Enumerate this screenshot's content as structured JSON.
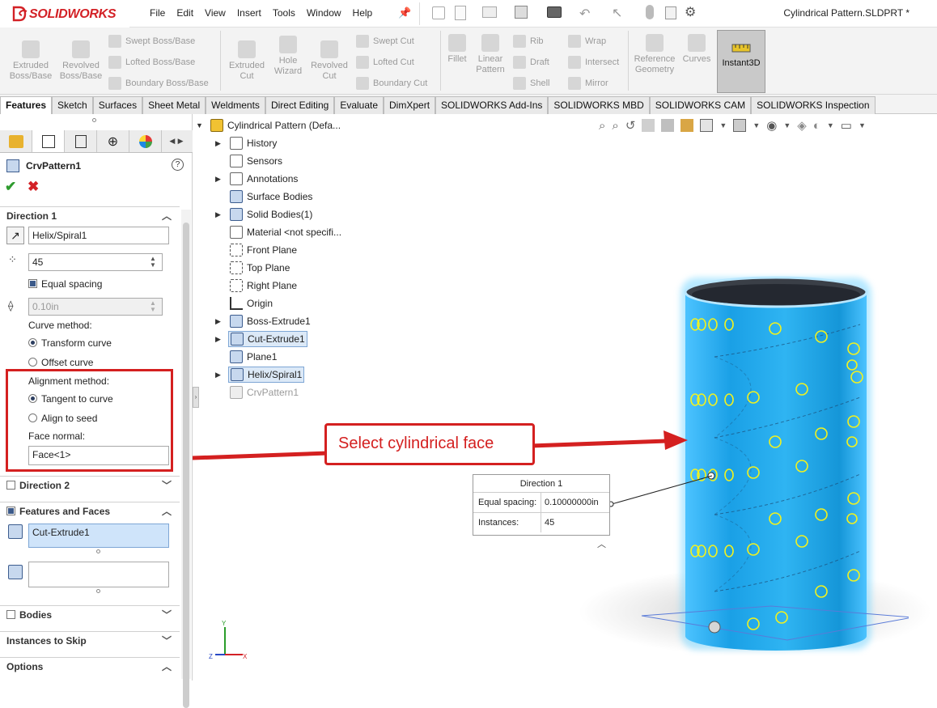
{
  "app": {
    "brand": "SOLIDWORKS",
    "menu": [
      "File",
      "Edit",
      "View",
      "Insert",
      "Tools",
      "Window",
      "Help"
    ],
    "document_title": "Cylindrical Pattern.SLDPRT *"
  },
  "ribbon": {
    "extruded_boss": "Extruded Boss/Base",
    "revolved_boss": "Revolved Boss/Base",
    "swept_boss": "Swept Boss/Base",
    "lofted_boss": "Lofted Boss/Base",
    "boundary_boss": "Boundary Boss/Base",
    "extruded_cut": "Extruded Cut",
    "hole_wizard": "Hole Wizard",
    "revolved_cut": "Revolved Cut",
    "swept_cut": "Swept Cut",
    "lofted_cut": "Lofted Cut",
    "boundary_cut": "Boundary Cut",
    "fillet": "Fillet",
    "linear_pattern": "Linear Pattern",
    "rib": "Rib",
    "draft": "Draft",
    "shell": "Shell",
    "wrap": "Wrap",
    "intersect": "Intersect",
    "mirror": "Mirror",
    "reference_geometry": "Reference Geometry",
    "curves": "Curves",
    "instant3d": "Instant3D"
  },
  "tabs": [
    "Features",
    "Sketch",
    "Surfaces",
    "Sheet Metal",
    "Weldments",
    "Direct Editing",
    "Evaluate",
    "DimXpert",
    "SOLIDWORKS Add-Ins",
    "SOLIDWORKS MBD",
    "SOLIDWORKS CAM",
    "SOLIDWORKS Inspection"
  ],
  "property_manager": {
    "feature_name": "CrvPattern1",
    "direction1": {
      "header": "Direction 1",
      "curve": "Helix/Spiral1",
      "instances": "45",
      "equal_spacing_label": "Equal spacing",
      "spacing": "0.10in",
      "curve_method_label": "Curve method:",
      "transform_curve": "Transform curve",
      "offset_curve": "Offset curve",
      "alignment_method_label": "Alignment method:",
      "tangent_to_curve": "Tangent to curve",
      "align_to_seed": "Align to seed",
      "face_normal_label": "Face normal:",
      "face_normal": "Face<1>"
    },
    "direction2_header": "Direction 2",
    "features_faces_header": "Features and Faces",
    "features_selected": "Cut-Extrude1",
    "bodies_header": "Bodies",
    "instances_to_skip_header": "Instances to Skip",
    "options_header": "Options"
  },
  "tree": {
    "root": "Cylindrical Pattern  (Defa...",
    "items": [
      "History",
      "Sensors",
      "Annotations",
      "Surface Bodies",
      "Solid Bodies(1)",
      "Material <not specifi...",
      "Front Plane",
      "Top Plane",
      "Right Plane",
      "Origin",
      "Boss-Extrude1",
      "Cut-Extrude1",
      "Plane1",
      "Helix/Spiral1",
      "CrvPattern1"
    ]
  },
  "callout": "Select cylindrical face",
  "direction_box": {
    "title": "Direction 1",
    "spacing_label": "Equal spacing:",
    "spacing_value": "0.10000000in",
    "instances_label": "Instances:",
    "instances_value": "45"
  },
  "colors": {
    "brand_red": "#d32126",
    "callout_red": "#d42020",
    "cylinder_blue": "#29a8ea",
    "pattern_yellow": "#f2f21e"
  }
}
